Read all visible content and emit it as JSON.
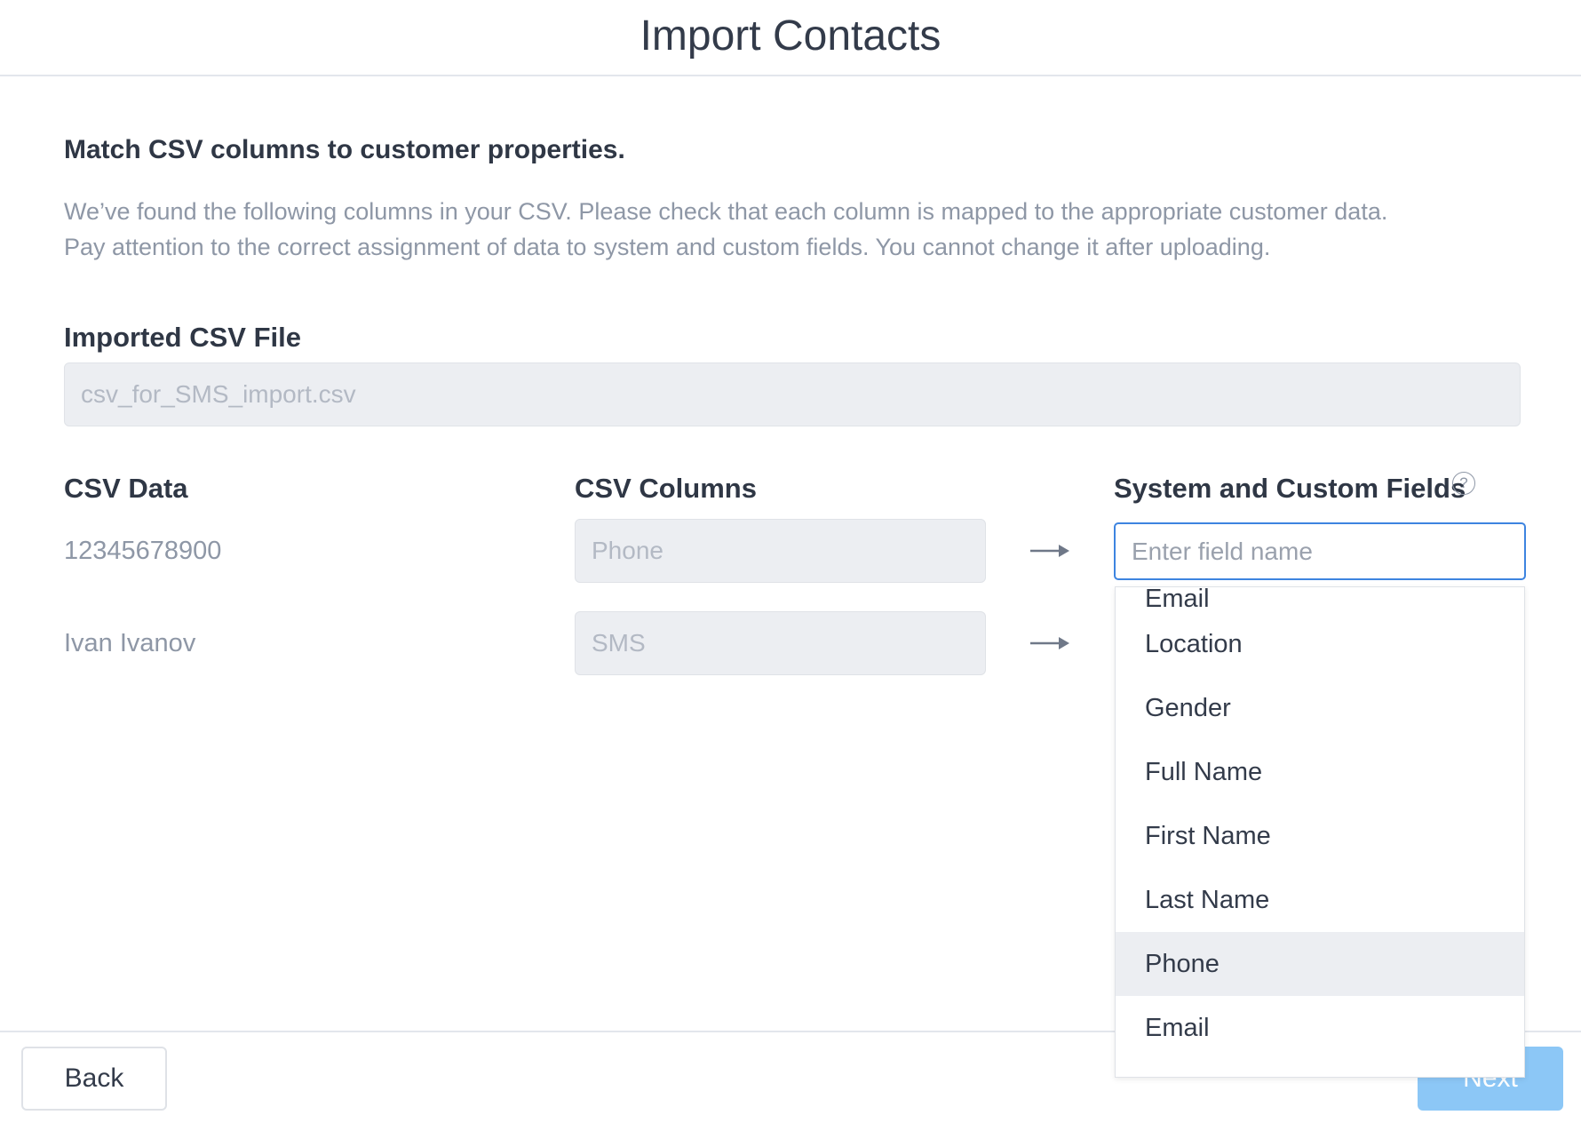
{
  "header": {
    "title": "Import Contacts"
  },
  "intro": {
    "heading": "Match CSV columns to customer properties.",
    "line1": "We’ve found the following columns in your CSV. Please check that each column is mapped to the appropriate customer data.",
    "line2": "Pay attention to the correct assignment of data to system and custom fields. You cannot change it after uploading."
  },
  "file": {
    "label": "Imported CSV File",
    "value": "csv_for_SMS_import.csv"
  },
  "columns": {
    "csv_data": "CSV Data",
    "csv_columns": "CSV Columns",
    "fields": "System and Custom Fields"
  },
  "rows": [
    {
      "data": "12345678900",
      "column": "Phone"
    },
    {
      "data": "Ivan Ivanov",
      "column": "SMS"
    }
  ],
  "field_input": {
    "placeholder": "Enter field name"
  },
  "dropdown": {
    "items": [
      "Email",
      "Location",
      "Gender",
      "Full Name",
      "First Name",
      "Last Name",
      "Phone",
      "Email"
    ],
    "highlighted": "Phone"
  },
  "footer": {
    "back": "Back",
    "next": "Next"
  },
  "colors": {
    "accent": "#3d84e0",
    "next_button": "#8cc7f6",
    "muted_text": "#8e97a6"
  },
  "icons": {
    "help": "question-circle-icon",
    "arrow": "arrow-right-icon"
  }
}
